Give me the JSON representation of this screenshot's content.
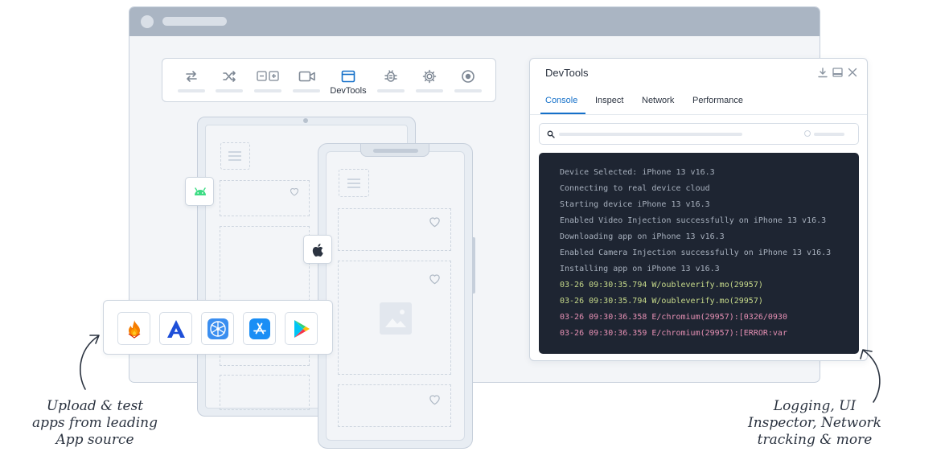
{
  "toolbar": {
    "items": [
      {
        "icon": "transfer-icon",
        "label": ""
      },
      {
        "icon": "shuffle-icon",
        "label": ""
      },
      {
        "icon": "zoom-icon",
        "label": ""
      },
      {
        "icon": "video-camera-icon",
        "label": ""
      },
      {
        "icon": "devtools-window-icon",
        "label": "DevTools"
      },
      {
        "icon": "bug-icon",
        "label": ""
      },
      {
        "icon": "gear-icon",
        "label": ""
      },
      {
        "icon": "record-icon",
        "label": ""
      }
    ]
  },
  "devtools": {
    "title": "DevTools",
    "tabs": [
      "Console",
      "Inspect",
      "Network",
      "Performance"
    ],
    "active_tab": "Console",
    "logs": [
      {
        "text": "Device Selected: iPhone 13 v16.3",
        "level": "info"
      },
      {
        "text": "Connecting to real device cloud",
        "level": "info"
      },
      {
        "text": "Starting device iPhone 13 v16.3",
        "level": "info"
      },
      {
        "text": "Enabled Video Injection successfully on iPhone 13 v16.3",
        "level": "info"
      },
      {
        "text": "Downloading app on iPhone 13 v16.3",
        "level": "info"
      },
      {
        "text": "Enabled Camera Injection successfully on iPhone 13 v16.3",
        "level": "info"
      },
      {
        "text": "Installing app on iPhone 13 v16.3",
        "level": "info"
      },
      {
        "text": "03-26 09:30:35.794 W/oubleverify.mo(29957)",
        "level": "warn"
      },
      {
        "text": "03-26 09:30:35.794 W/oubleverify.mo(29957)",
        "level": "warn"
      },
      {
        "text": "03-26 09:30:36.358 E/chromium(29957):[0326/0930",
        "level": "error"
      },
      {
        "text": "03-26 09:30:36.359 E/chromium(29957):[ERROR:var",
        "level": "error"
      }
    ]
  },
  "app_sources": [
    "firebase-icon",
    "app-center-icon",
    "testflight-icon",
    "app-store-icon",
    "google-play-icon"
  ],
  "captions": {
    "left": [
      "Upload & test",
      "apps from leading",
      "App source"
    ],
    "right": [
      "Logging, UI",
      "Inspector, Network",
      "tracking & more"
    ]
  },
  "colors": {
    "accent": "#1470c9",
    "console_bg": "#1e2532",
    "log_info": "#a7b0bd",
    "log_warn": "#c6d98a",
    "log_error": "#e58fb3",
    "android_green": "#3ddc84"
  }
}
